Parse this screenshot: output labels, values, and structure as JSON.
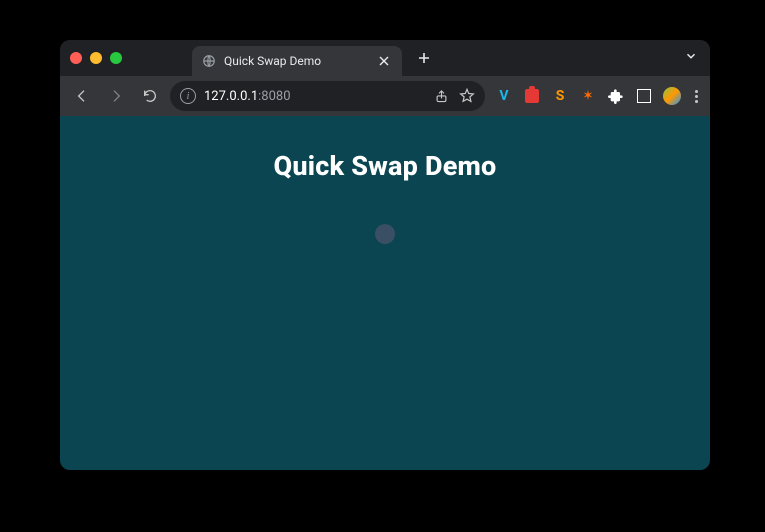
{
  "tab": {
    "title": "Quick Swap Demo"
  },
  "address": {
    "host": "127.0.0.1",
    "port": ":8080"
  },
  "page": {
    "title": "Quick Swap Demo"
  }
}
